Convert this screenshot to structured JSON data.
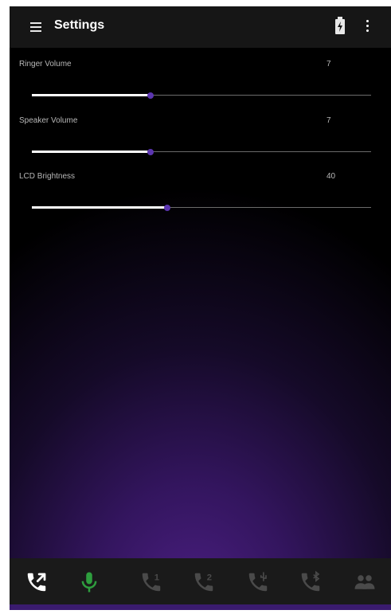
{
  "appbar": {
    "title": "Settings",
    "menu_icon": "hamburger-menu-icon",
    "battery_icon": "battery-charging-icon",
    "overflow_icon": "more-vert-icon"
  },
  "settings": [
    {
      "label": "Ringer Volume",
      "value": "7",
      "level_fraction": 0.35
    },
    {
      "label": "Speaker Volume",
      "value": "7",
      "level_fraction": 0.35
    },
    {
      "label": "LCD Brightness",
      "value": "40",
      "level_fraction": 0.4
    }
  ],
  "bottom_nav": {
    "items": [
      {
        "icon": "call-transfer-icon",
        "state": "active"
      },
      {
        "icon": "microphone-icon",
        "state": "active-green"
      },
      {
        "icon": "line-1-call-icon",
        "state": "disabled",
        "badge": "1"
      },
      {
        "icon": "line-2-call-icon",
        "state": "disabled",
        "badge": "2"
      },
      {
        "icon": "usb-call-icon",
        "state": "disabled"
      },
      {
        "icon": "bluetooth-call-icon",
        "state": "disabled"
      },
      {
        "icon": "conference-icon",
        "state": "disabled"
      }
    ]
  },
  "colors": {
    "appbar_background": "#161616",
    "slider_fill": "#ffffff",
    "slider_thumb": "#5b35b0",
    "mic_active": "#2e9e3e",
    "icon_active": "#ffffff",
    "icon_disabled": "#4a4a4a",
    "background_glow": "#4b1f82"
  }
}
